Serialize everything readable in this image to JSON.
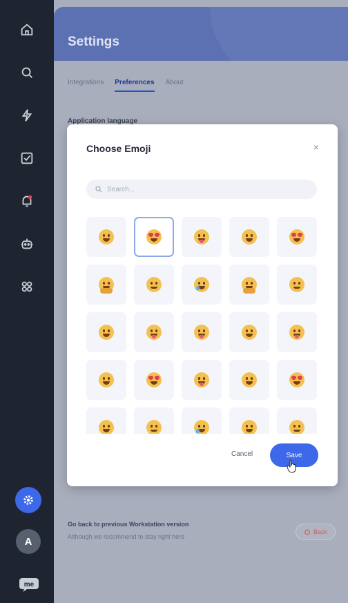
{
  "sidebar": {
    "icons": [
      "home-icon",
      "search-icon",
      "lightning-icon",
      "checkbox-icon",
      "bell-notification-icon",
      "robot-icon",
      "apps-grid-icon"
    ],
    "avatar_initial": "A",
    "logo_text": "me"
  },
  "header": {
    "title": "Settings"
  },
  "tabs": [
    {
      "label": "Integrations",
      "active": false
    },
    {
      "label": "Preferences",
      "active": true
    },
    {
      "label": "About",
      "active": false
    }
  ],
  "settings": {
    "language_label": "Application language",
    "back_title": "Go back to previous Workstation version",
    "back_subtitle": "Although we recommend to stay right here",
    "back_button": "Back"
  },
  "modal": {
    "title": "Choose Emoji",
    "close_label": "×",
    "search_placeholder": "Search...",
    "emojis": [
      "grin",
      "heart-eyes",
      "tongue",
      "grin",
      "heart-eyes",
      "hug",
      "smile",
      "tear-laugh",
      "hug",
      "smile",
      "grin",
      "tongue",
      "tongue",
      "grin",
      "tongue",
      "grin",
      "heart-eyes",
      "tongue",
      "grin",
      "heart-eyes",
      "grin",
      "smile",
      "tear-laugh",
      "grin",
      "smile"
    ],
    "selected_index": 1,
    "cancel_label": "Cancel",
    "save_label": "Save"
  },
  "colors": {
    "accent": "#3e68ea",
    "sidebar_bg": "#1f2530",
    "header_bg": "#5c71b2",
    "notification_dot": "#e0424f"
  }
}
